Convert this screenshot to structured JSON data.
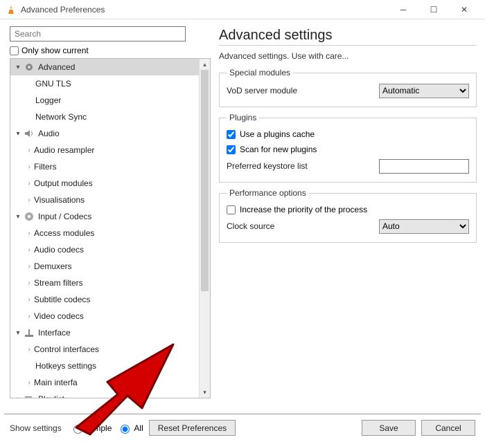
{
  "window": {
    "title": "Advanced Preferences"
  },
  "search": {
    "placeholder": "Search"
  },
  "only_show_current": "Only show current",
  "tree": {
    "advanced": "Advanced",
    "gnu_tls": "GNU TLS",
    "logger": "Logger",
    "network_sync": "Network Sync",
    "audio": "Audio",
    "audio_resampler": "Audio resampler",
    "filters": "Filters",
    "output_modules": "Output modules",
    "visualisations": "Visualisations",
    "input_codecs": "Input / Codecs",
    "access_modules": "Access modules",
    "audio_codecs": "Audio codecs",
    "demuxers": "Demuxers",
    "stream_filters": "Stream filters",
    "subtitle_codecs": "Subtitle codecs",
    "video_codecs": "Video codecs",
    "interface": "Interface",
    "control_interfaces": "Control interfaces",
    "hotkeys_settings": "Hotkeys settings",
    "main_interfaces": "Main interfa",
    "playlist": "Playlist"
  },
  "heading": "Advanced settings",
  "subdesc": "Advanced settings. Use with care...",
  "groups": {
    "special_modules": "Special modules",
    "plugins": "Plugins",
    "performance": "Performance options"
  },
  "labels": {
    "vod_server": "VoD server module",
    "use_plugins_cache": "Use a plugins cache",
    "scan_new_plugins": "Scan for new plugins",
    "preferred_keystore": "Preferred keystore list",
    "increase_priority": "Increase the priority of the process",
    "clock_source": "Clock source"
  },
  "values": {
    "vod_server": "Automatic",
    "clock_source": "Auto",
    "keystore": ""
  },
  "bottom": {
    "show_settings": "Show settings",
    "simple": "Simple",
    "all": "All",
    "reset": "Reset Preferences",
    "save": "Save",
    "cancel": "Cancel"
  }
}
